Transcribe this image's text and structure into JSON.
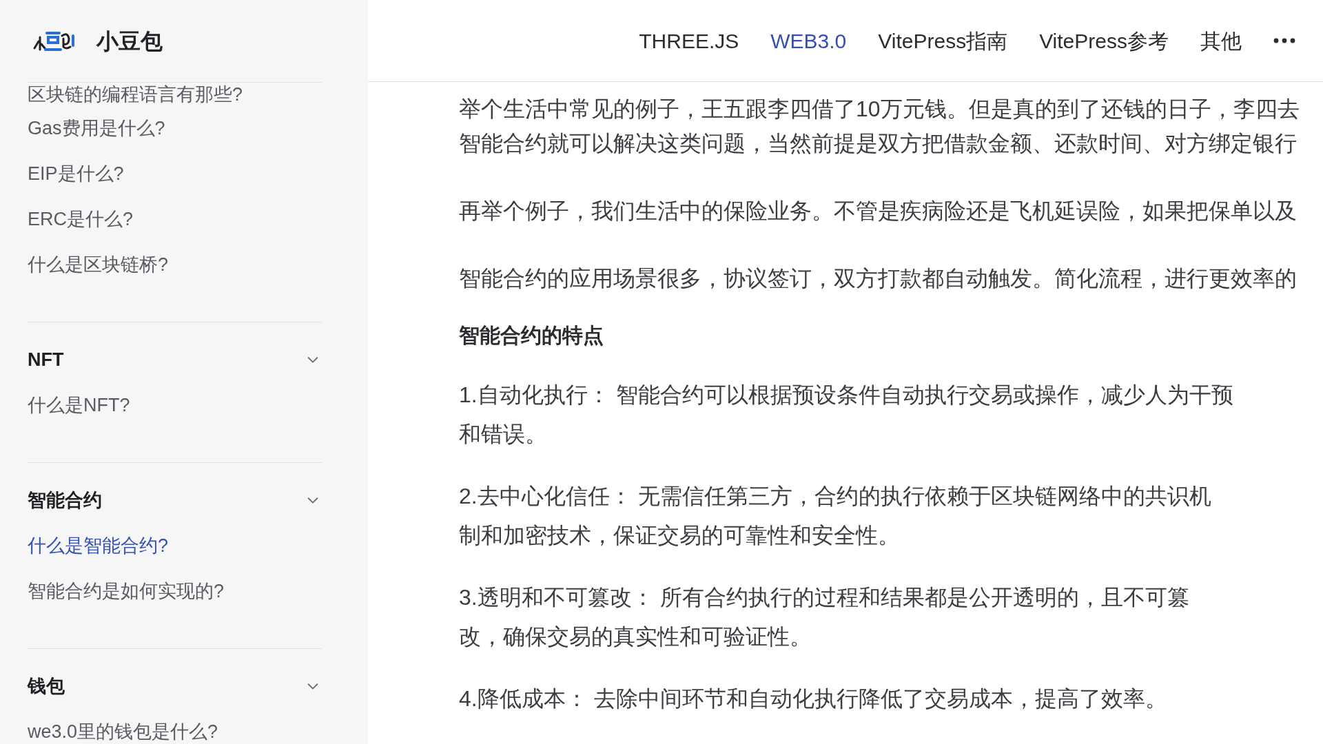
{
  "logo": {
    "title": "小豆包"
  },
  "nav": [
    {
      "label": "THREE.JS",
      "selected": false
    },
    {
      "label": "WEB3.0",
      "selected": true
    },
    {
      "label": "VitePress指南",
      "selected": false
    },
    {
      "label": "VitePress参考",
      "selected": false
    },
    {
      "label": "其他",
      "selected": false
    }
  ],
  "sidebar": {
    "groups": [
      {
        "items": [
          {
            "label": "区块链的编程语言有那些?",
            "selected": false
          },
          {
            "label": "Gas费用是什么?",
            "selected": false
          },
          {
            "label": "EIP是什么?",
            "selected": false
          },
          {
            "label": "ERC是什么?",
            "selected": false
          },
          {
            "label": "什么是区块链桥?",
            "selected": false
          }
        ]
      },
      {
        "title": "NFT",
        "expanded": true,
        "items": [
          {
            "label": "什么是NFT?",
            "selected": false
          }
        ]
      },
      {
        "title": "智能合约",
        "expanded": true,
        "items": [
          {
            "label": "什么是智能合约?",
            "selected": true
          },
          {
            "label": "智能合约是如何实现的?",
            "selected": false
          }
        ]
      },
      {
        "title": "钱包",
        "expanded": true,
        "items": [
          {
            "label": "we3.0里的钱包是什么?",
            "selected": false
          }
        ]
      }
    ]
  },
  "article": {
    "paragraphs": [
      {
        "lines": [
          "举个生活中常见的例子，王五跟李四借了10万元钱。但是真的到了还钱的日子，李四去",
          "智能合约就可以解决这类问题，当然前提是双方把借款金额、还款时间、对方绑定银行"
        ]
      },
      {
        "lines": [
          "再举个例子，我们生活中的保险业务。不管是疾病险还是飞机延误险，如果把保单以及"
        ]
      },
      {
        "lines": [
          "智能合约的应用场景很多，协议签订，双方打款都自动触发。简化流程，进行更效率的"
        ]
      }
    ],
    "heading": "智能合约的特点",
    "list": [
      {
        "lines": [
          "1.自动化执行： 智能合约可以根据预设条件自动执行交易或操作，减少人为干预",
          "和错误。"
        ]
      },
      {
        "lines": [
          "2.去中心化信任： 无需信任第三方，合约的执行依赖于区块链网络中的共识机",
          "制和加密技术，保证交易的可靠性和安全性。"
        ]
      },
      {
        "lines": [
          "3.透明和不可篡改： 所有合约执行的过程和结果都是公开透明的，且不可篡",
          "改，确保交易的真实性和可验证性。"
        ]
      },
      {
        "lines": [
          "4.降低成本： 去除中间环节和自动化执行降低了交易成本，提高了效率。"
        ]
      }
    ]
  }
}
